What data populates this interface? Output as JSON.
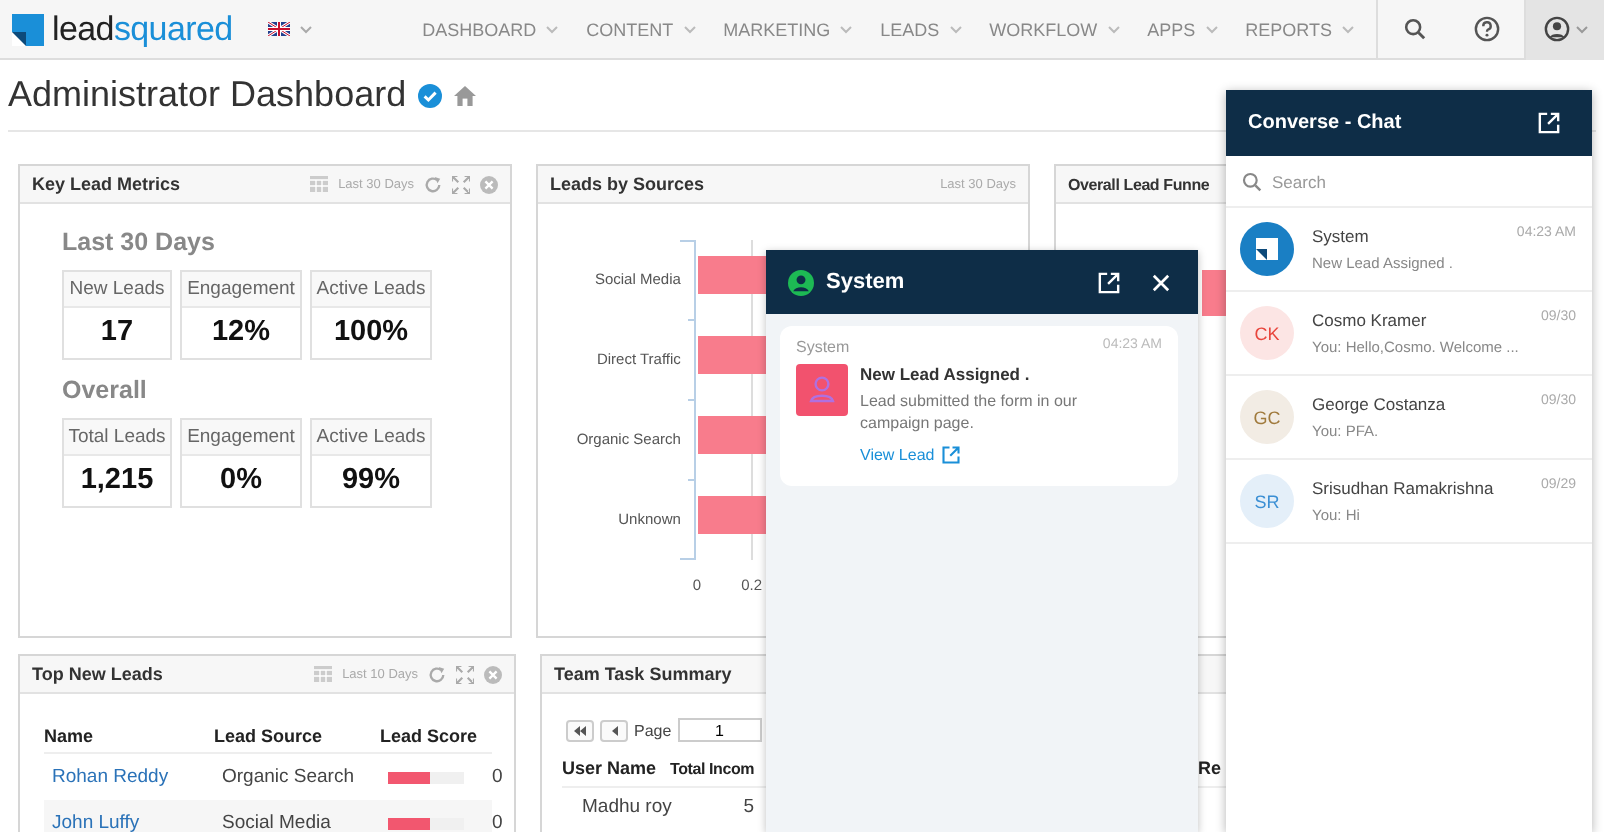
{
  "header": {
    "logo": {
      "dark": "lead",
      "accent": "squared"
    },
    "nav": [
      {
        "label": "DASHBOARD"
      },
      {
        "label": "CONTENT"
      },
      {
        "label": "MARKETING"
      },
      {
        "label": "LEADS"
      },
      {
        "label": "WORKFLOW"
      },
      {
        "label": "APPS"
      },
      {
        "label": "REPORTS"
      }
    ]
  },
  "page_title": "Administrator Dashboard",
  "key_lead_metrics": {
    "title": "Key Lead Metrics",
    "range": "Last 30 Days",
    "sections": [
      {
        "heading": "Last 30 Days",
        "metrics": [
          {
            "label": "New Leads",
            "value": "17"
          },
          {
            "label": "Engagement",
            "value": "12%"
          },
          {
            "label": "Active Leads",
            "value": "100%"
          }
        ]
      },
      {
        "heading": "Overall",
        "metrics": [
          {
            "label": "Total Leads",
            "value": "1,215"
          },
          {
            "label": "Engagement",
            "value": "0%"
          },
          {
            "label": "Active Leads",
            "value": "99%"
          }
        ]
      }
    ]
  },
  "leads_by_sources": {
    "title": "Leads by Sources",
    "range": "Last 30 Days",
    "categories": [
      "Social Media",
      "Direct Traffic",
      "Organic Search",
      "Unknown"
    ],
    "ticks": [
      "0",
      "0.2"
    ]
  },
  "lead_funnel": {
    "title": "Overall Lead Funne"
  },
  "top_new_leads": {
    "title": "Top New Leads",
    "range": "Last 10 Days",
    "columns": [
      "Name",
      "Lead Source",
      "Lead Score"
    ],
    "rows": [
      {
        "name": "Rohan Reddy",
        "source": "Organic Search",
        "level": 0.55,
        "score": "0"
      },
      {
        "name": "John Luffy",
        "source": "Social Media",
        "level": 0.55,
        "score": "0"
      }
    ]
  },
  "team_task_summary": {
    "title": "Team Task Summary",
    "page_label": "Page",
    "page": "1",
    "columns": [
      "User Name",
      "Total Incom",
      "Re"
    ],
    "rows": [
      {
        "user": "Madhu roy",
        "total": "5"
      }
    ]
  },
  "system_popup": {
    "title": "System",
    "sender": "System",
    "time": "04:23 AM",
    "message_title": "New Lead Assigned .",
    "message": "Lead submitted the form in our campaign page.",
    "link": "View Lead"
  },
  "converse_chat": {
    "title": "Converse - Chat",
    "search": {
      "placeholder": "Search"
    },
    "items": [
      {
        "kind": "system",
        "name": "System",
        "time": "04:23 AM",
        "preview": "New Lead Assigned ."
      },
      {
        "kind": "person",
        "initials": "CK",
        "color": "#e8453c",
        "name": "Cosmo Kramer",
        "time": "09/30",
        "preview": "You: Hello,Cosmo. Welcome ..."
      },
      {
        "kind": "person",
        "initials": "GC",
        "color": "#a07a3c",
        "name": "George Costanza",
        "time": "09/30",
        "preview": "You: PFA."
      },
      {
        "kind": "person",
        "initials": "SR",
        "color": "#3b8fd4",
        "name": "Srisudhan Ramakrishna",
        "time": "09/29",
        "preview": "You: Hi"
      }
    ]
  }
}
